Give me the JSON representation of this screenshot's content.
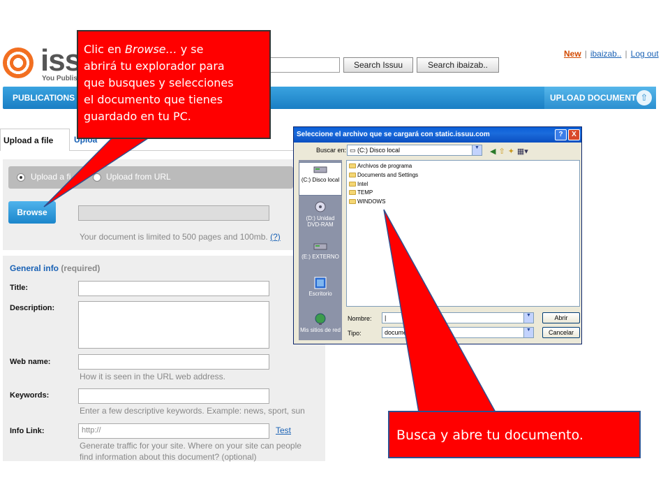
{
  "header": {
    "logo_text": "iss",
    "logo_subtitle": "You Publis",
    "search_issuu_label": "Search Issuu",
    "search_user_label": "Search ibaizab..",
    "top_links": {
      "new": "New",
      "user": "ibaizab..",
      "separator": "|",
      "logout": "Log out"
    }
  },
  "nav": {
    "publications": "PUBLICATIONS",
    "upload_document": "UPLOAD DOCUMENT",
    "upload_icon": "⇧"
  },
  "tabs": {
    "upload_file": "Upload a file",
    "other": "Uploa"
  },
  "upload": {
    "radio_file_label": "Upload a fi",
    "radio_url_label": "Upload from URL",
    "browse_label": "Browse",
    "limit_text": "Your document is limited to 500 pages and 100mb.",
    "limit_help": "(?)"
  },
  "general_info": {
    "title": "General info",
    "required": "(required)",
    "fields": {
      "title_label": "Title:",
      "description_label": "Description:",
      "webname_label": "Web name:",
      "webname_hint": "How it is seen in the URL web address.",
      "keywords_label": "Keywords:",
      "keywords_hint": "Enter a few descriptive keywords. Example: news, sport, sun",
      "infolink_label": "Info Link:",
      "infolink_placeholder": "http://",
      "infolink_test": "Test",
      "infolink_hint_1": "Generate traffic for your site. Where on your site can people",
      "infolink_hint_2": "find information about this document? (optional)"
    }
  },
  "dialog": {
    "title": "Seleccione el archivo que se cargará con static.issuu.com",
    "help_button": "?",
    "close_button": "X",
    "look_in_label": "Buscar en:",
    "look_in_value": "(C:) Disco local",
    "places": [
      {
        "label_1": "(C:) Disco local",
        "label_2": ""
      },
      {
        "label_1": "(D:) Unidad",
        "label_2": "DVD-RAM"
      },
      {
        "label_1": "(E:) EXTERNO",
        "label_2": ""
      },
      {
        "label_1": "Escritorio",
        "label_2": ""
      },
      {
        "label_1": "Mis sitios de red",
        "label_2": ""
      }
    ],
    "files": [
      "Archivos de programa",
      "Documents and Settings",
      "Intel",
      "TEMP",
      "WINDOWS"
    ],
    "name_label": "Nombre:",
    "name_value": "|",
    "type_label": "Tipo:",
    "type_value": "documents",
    "open_button": "Abrir",
    "cancel_button": "Cancelar"
  },
  "callouts": {
    "browse_line_1": "Clic en ",
    "browse_emph": "Browse…",
    "browse_line_1b": " y se",
    "browse_line_2": "abrirá tu explorador para",
    "browse_line_3": "que busques y selecciones",
    "browse_line_4": "el documento que tienes",
    "browse_line_5": "guardado en tu PC.",
    "open_text": "Busca y abre tu documento."
  },
  "colors": {
    "callout_red": "#ff0000",
    "issuu_blue": "#1a7ec4",
    "issuu_orange": "#f26f21"
  }
}
